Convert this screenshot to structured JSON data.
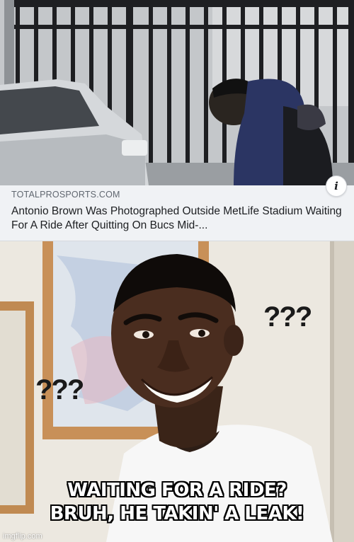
{
  "link_card": {
    "domain": "TOTALPROSPORTS.COM",
    "title": "Antonio Brown Was Photographed Outside MetLife Stadium Waiting For A Ride After Quitting On Bucs Mid-...",
    "info_icon": "info-icon"
  },
  "meme": {
    "question_marks_right": "???",
    "question_marks_left": "???",
    "caption_line1": "WAITING FOR A RIDE?",
    "caption_line2": "BRUH, HE TAKIN' A LEAK!",
    "watermark": "imgflip.com"
  }
}
